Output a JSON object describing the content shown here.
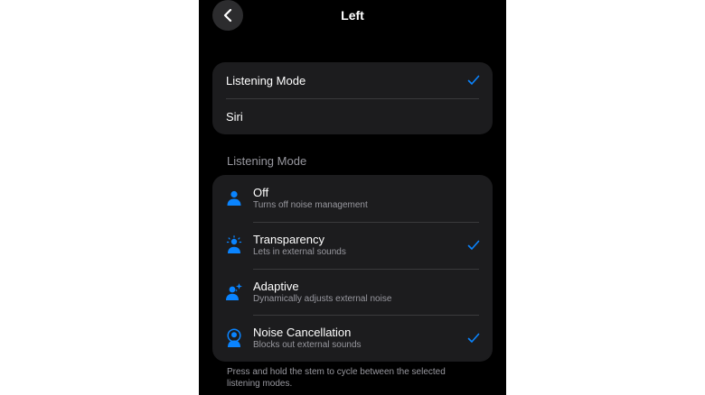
{
  "header": {
    "title": "Left",
    "back_icon": "chevron-left-icon"
  },
  "press_hold_options": [
    {
      "label": "Listening Mode",
      "selected": true
    },
    {
      "label": "Siri",
      "selected": false
    }
  ],
  "listening_mode": {
    "header": "Listening Mode",
    "modes": [
      {
        "title": "Off",
        "subtitle": "Turns off noise management",
        "selected": false,
        "icon": "person-off-icon"
      },
      {
        "title": "Transparency",
        "subtitle": "Lets in external sounds",
        "selected": true,
        "icon": "person-transparency-icon"
      },
      {
        "title": "Adaptive",
        "subtitle": "Dynamically adjusts external noise",
        "selected": false,
        "icon": "person-adaptive-icon"
      },
      {
        "title": "Noise Cancellation",
        "subtitle": "Blocks out external sounds",
        "selected": true,
        "icon": "person-noise-cancellation-icon"
      }
    ],
    "footer": "Press and hold the stem to cycle between the selected listening modes."
  },
  "colors": {
    "accent": "#0a84ff",
    "background": "#000000",
    "card": "#1c1c1e",
    "secondary_text": "#98989f",
    "separator": "#3a3a3c"
  }
}
